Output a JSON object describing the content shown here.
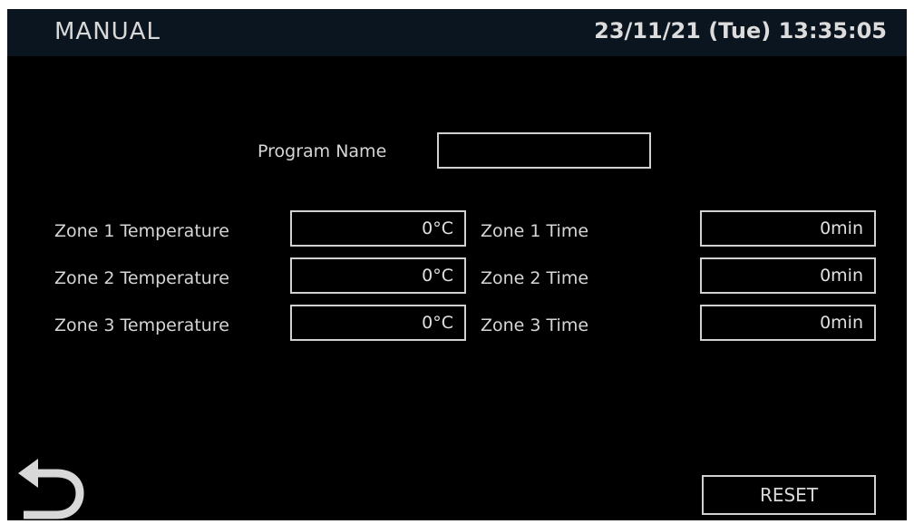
{
  "header": {
    "mode": "MANUAL",
    "datetime": "23/11/21 (Tue) 13:35:05"
  },
  "program": {
    "label": "Program Name",
    "value": ""
  },
  "zones": [
    {
      "temp_label": "Zone 1 Temperature",
      "temp_value": "0°C",
      "time_label": "Zone 1 Time",
      "time_value": "0min"
    },
    {
      "temp_label": "Zone 2 Temperature",
      "temp_value": "0°C",
      "time_label": "Zone 2 Time",
      "time_value": "0min"
    },
    {
      "temp_label": "Zone 3 Temperature",
      "temp_value": "0°C",
      "time_label": "Zone 3 Time",
      "time_value": "0min"
    }
  ],
  "actions": {
    "reset_label": "RESET",
    "back_icon": "back-arrow-icon"
  },
  "colors": {
    "background": "#000000",
    "header_background": "#0a1520",
    "text": "#e8e8e8",
    "field_border": "#d0d0d0"
  }
}
